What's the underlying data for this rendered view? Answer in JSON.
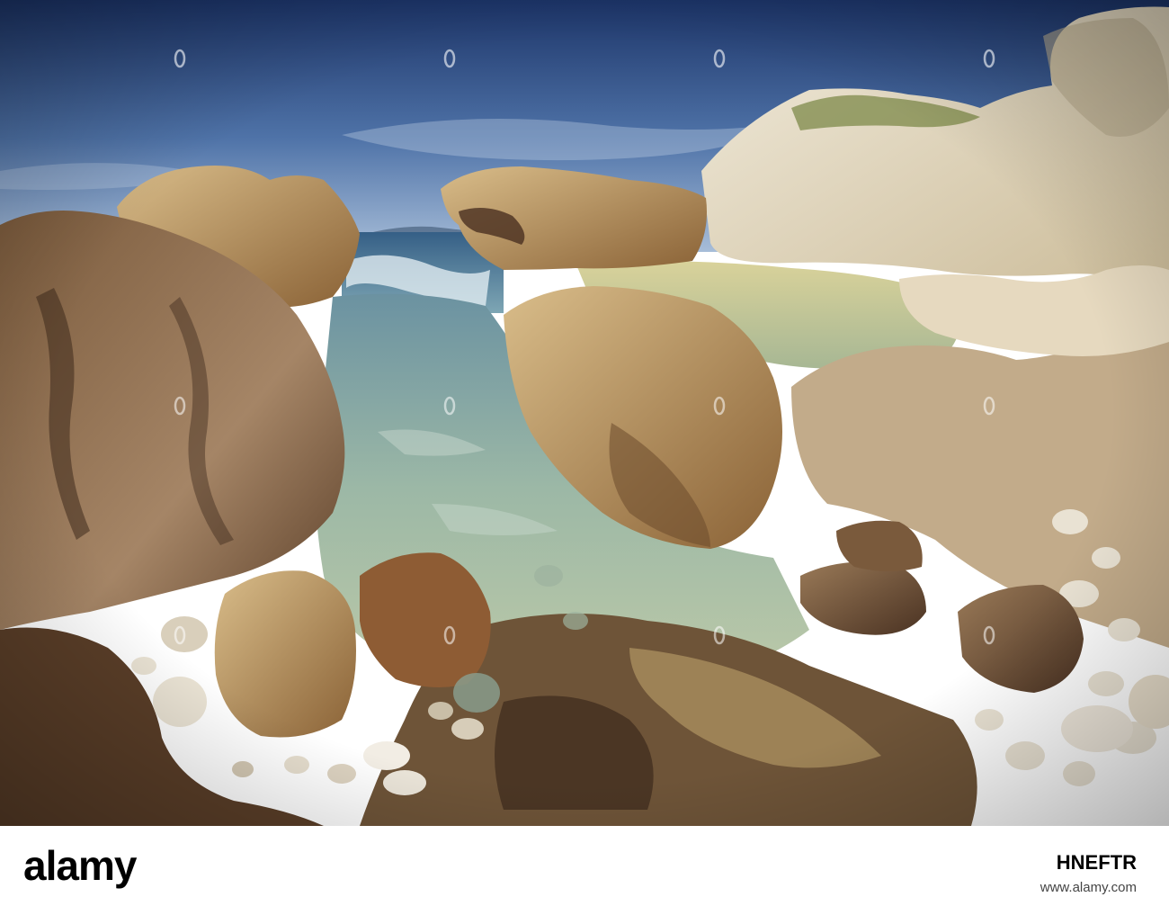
{
  "scene": {
    "description_tags": [
      "rocky-coast",
      "tide-pool",
      "sea",
      "sky"
    ],
    "colors": {
      "sky_top": "#1f3a6e",
      "sky_bottom": "#7f9fc6",
      "sea": "#3f6f8f",
      "foam": "#e8f1f5",
      "rock_light": "#e3d4b4",
      "rock_warm": "#b58a52",
      "rock_dark": "#5b3e28",
      "water_pool": "#9fb39a"
    }
  },
  "watermark": {
    "text": "a",
    "brand": "alamy"
  },
  "footer": {
    "logo_text": "alamy",
    "stock_id": "HNEFTR",
    "site": "www.alamy.com"
  }
}
